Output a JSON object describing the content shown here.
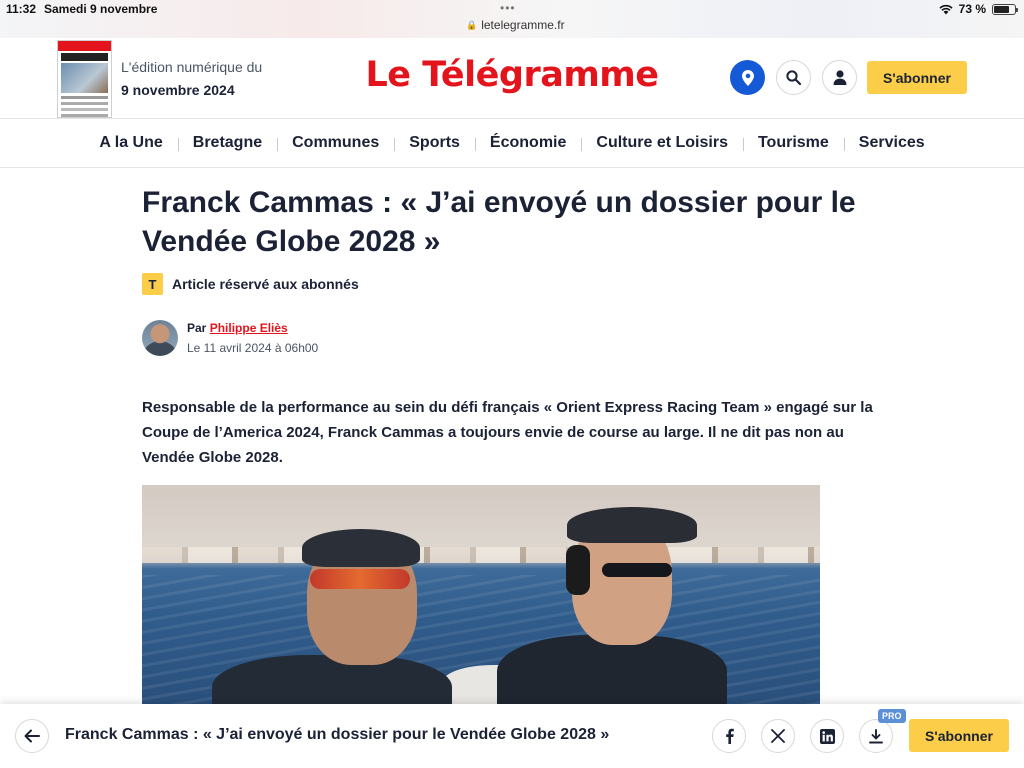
{
  "status_bar": {
    "time": "11:32",
    "date": "Samedi 9 novembre",
    "url": "letelegramme.fr",
    "battery": "73 %"
  },
  "header": {
    "edition_line1": "L'édition numérique du",
    "edition_line2": "9 novembre 2024",
    "logo": "Le Télégramme",
    "subscribe_label": "S'abonner",
    "accent_color": "#e3141c",
    "subscribe_color": "#fbcd48",
    "location_color": "#1459d6"
  },
  "nav": {
    "items": [
      "A la Une",
      "Bretagne",
      "Communes",
      "Sports",
      "Économie",
      "Culture et Loisirs",
      "Tourisme",
      "Services"
    ]
  },
  "article": {
    "title": "Franck Cammas : « J’ai envoyé un dossier pour le Vendée Globe 2028 »",
    "badge": "T",
    "access_label": "Article réservé aux abonnés",
    "author_prefix": "Par",
    "author_name": "Philippe Eliès",
    "date": "Le 11 avril 2024 à 06h00",
    "lead": "Responsable de la performance au sein du défi français « Orient Express Racing Team » engagé sur la Coupe de l’America 2024, Franck Cammas a toujours envie de course au large. Il ne dit pas non au Vendée Globe 2028."
  },
  "bottom_bar": {
    "title": "Franck Cammas : « J’ai envoyé un dossier pour le Vendée Globe 2028 »",
    "pro_badge": "PRO",
    "subscribe_label": "S'abonner",
    "icons": [
      "back-arrow-icon",
      "facebook-icon",
      "x-icon",
      "linkedin-icon",
      "download-icon"
    ]
  }
}
